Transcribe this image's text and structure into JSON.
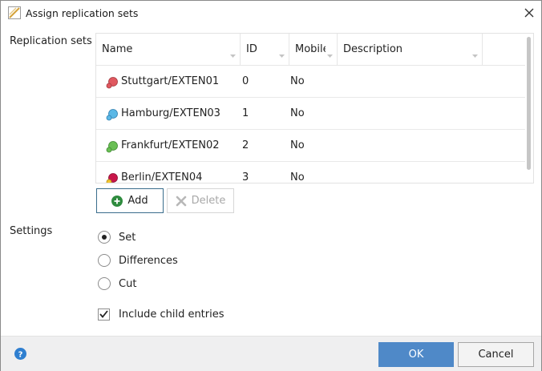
{
  "window": {
    "title": "Assign replication sets",
    "icon": "app-document-icon",
    "close_icon": "close-icon"
  },
  "replication": {
    "section_label": "Replication sets",
    "columns": [
      {
        "label": "Name"
      },
      {
        "label": "ID"
      },
      {
        "label": "Mobile"
      },
      {
        "label": "Description"
      }
    ],
    "rows": [
      {
        "name": "Stuttgart/EXTEN01",
        "id": "0",
        "mobile": "No",
        "description": "",
        "color": "#e0585f"
      },
      {
        "name": "Hamburg/EXTEN03",
        "id": "1",
        "mobile": "No",
        "description": "",
        "color": "#5bb8e6"
      },
      {
        "name": "Frankfurt/EXTEN02",
        "id": "2",
        "mobile": "No",
        "description": "",
        "color": "#6abf55"
      },
      {
        "name": "Berlin/EXTEN04",
        "id": "3",
        "mobile": "No",
        "description": "",
        "color": "#c8164a"
      }
    ],
    "add_label": "Add",
    "delete_label": "Delete"
  },
  "settings": {
    "section_label": "Settings",
    "options": [
      {
        "label": "Set",
        "checked": true
      },
      {
        "label": "Differences",
        "checked": false
      },
      {
        "label": "Cut",
        "checked": false
      }
    ],
    "include_child_label": "Include child entries",
    "include_child_checked": true
  },
  "footer": {
    "ok_label": "OK",
    "cancel_label": "Cancel",
    "help_icon": "help-icon"
  },
  "colors": {
    "ok_button": "#4f89c8",
    "add_icon": "#2e8b3e",
    "help_icon": "#2f7fd0"
  }
}
